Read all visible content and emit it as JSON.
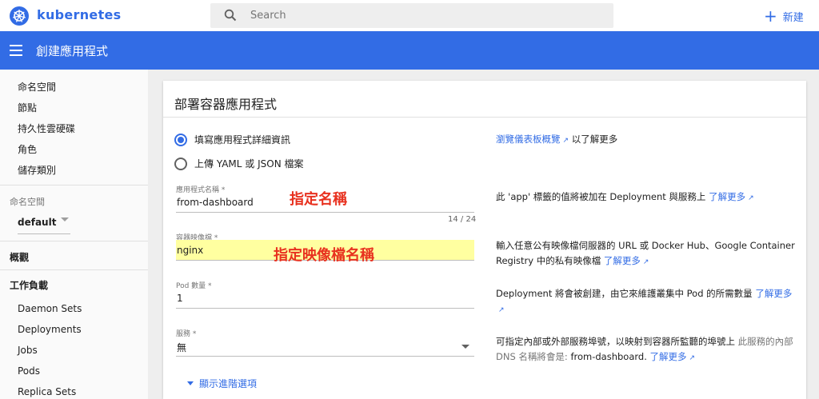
{
  "topbar": {
    "brand": "kubernetes",
    "search_placeholder": "Search",
    "create_label": "新建"
  },
  "appbar": {
    "title": "創建應用程式"
  },
  "sidebar": {
    "top_items": [
      "命名空間",
      "節點",
      "持久性雲硬碟",
      "角色",
      "儲存類別"
    ],
    "namespace_label": "命名空間",
    "namespace_value": "default",
    "overview_label": "概觀",
    "workloads_label": "工作負載",
    "workload_items": [
      "Daemon Sets",
      "Deployments",
      "Jobs",
      "Pods",
      "Replica Sets"
    ]
  },
  "card": {
    "title": "部署容器應用程式",
    "radio_fill": "填寫應用程式詳細資訊",
    "radio_upload": "上傳 YAML 或 JSON 檔案",
    "radio_selected": "填寫應用程式詳細資訊",
    "app_name_label": "應用程式名稱 *",
    "app_name_value": "from-dashboard",
    "app_name_counter": "14 / 24",
    "image_label": "容器映像檔 *",
    "image_value": "nginx",
    "pods_label": "Pod 數量 *",
    "pods_value": "1",
    "service_label": "服務 *",
    "service_value": "無",
    "advanced_label": "顯示進階選項"
  },
  "annotations": {
    "name": "指定名稱",
    "image": "指定映像檔名稱"
  },
  "help": {
    "overview_link": "瀏覽儀表板概覽",
    "overview_suffix": "以了解更多",
    "learn_more": "了解更多",
    "app_name_text": "此 'app' 標籤的值將被加在 Deployment 與服務上",
    "image_text": "輸入任意公有映像檔伺服器的 URL 或 Docker Hub、Google Container Registry 中的私有映像檔",
    "pods_text": "Deployment 將會被創建，由它來維護叢集中 Pod 的所需數量",
    "service_text": "可指定內部或外部服務埠號，以映射到容器所監聽的埠號上",
    "service_muted": "此服務的內部 DNS 名稱將會是:",
    "service_dns": "from-dashboard."
  },
  "colors": {
    "accent": "#326ce5",
    "annotation": "#e8311f",
    "highlight": "#ffffa0"
  }
}
